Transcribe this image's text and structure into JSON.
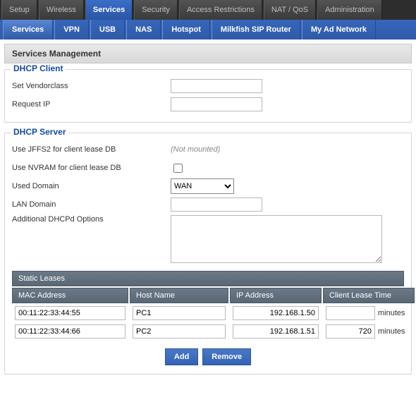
{
  "topnav": {
    "tabs": [
      "Setup",
      "Wireless",
      "Services",
      "Security",
      "Access Restrictions",
      "NAT / QoS",
      "Administration"
    ],
    "active": 2
  },
  "subnav": {
    "tabs": [
      "Services",
      "VPN",
      "USB",
      "NAS",
      "Hotspot",
      "Milkfish SIP Router",
      "My Ad Network"
    ],
    "active": 0
  },
  "section_title": "Services Management",
  "dhcp_client": {
    "legend": "DHCP Client",
    "vendorclass_label": "Set Vendorclass",
    "vendorclass_value": "",
    "request_ip_label": "Request IP",
    "request_ip_value": ""
  },
  "dhcp_server": {
    "legend": "DHCP Server",
    "jffs2_label": "Use JFFS2 for client lease DB",
    "jffs2_note": "(Not mounted)",
    "nvram_label": "Use NVRAM for client lease DB",
    "nvram_checked": false,
    "used_domain_label": "Used Domain",
    "used_domain_value": "WAN",
    "lan_domain_label": "LAN Domain",
    "lan_domain_value": "",
    "dhcpd_options_label": "Additional DHCPd Options",
    "dhcpd_options_value": "",
    "static_leases_title": "Static Leases",
    "cols": {
      "mac": "MAC Address",
      "host": "Host Name",
      "ip": "IP Address",
      "lease": "Client Lease Time"
    },
    "minutes_label": "minutes",
    "leases": [
      {
        "mac": "00:11:22:33:44:55",
        "host": "PC1",
        "ip": "192.168.1.50",
        "lease": ""
      },
      {
        "mac": "00:11:22:33:44:66",
        "host": "PC2",
        "ip": "192.168.1.51",
        "lease": "720"
      }
    ],
    "add_label": "Add",
    "remove_label": "Remove"
  }
}
